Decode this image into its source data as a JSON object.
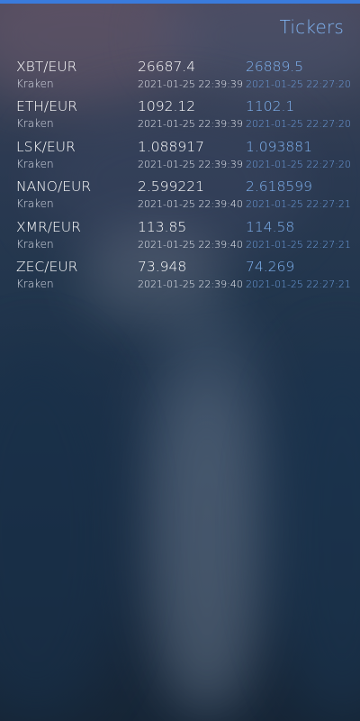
{
  "header": {
    "title": "Tickers"
  },
  "colors": {
    "accent": "#3a7bdc",
    "highlight": "#7fb2f0",
    "highlight_dim": "#6d9fe0",
    "text": "#ffffff",
    "secondary": "#d7dbe6"
  },
  "tickers": [
    {
      "pair": "XBT/EUR",
      "exchange": "Kraken",
      "price": "26687.4",
      "time": "2021-01-25 22:39:39",
      "prev_price": "26889.5",
      "prev_time": "2021-01-25 22:27:20"
    },
    {
      "pair": "ETH/EUR",
      "exchange": "Kraken",
      "price": "1092.12",
      "time": "2021-01-25 22:39:39",
      "prev_price": "1102.1",
      "prev_time": "2021-01-25 22:27:20"
    },
    {
      "pair": "LSK/EUR",
      "exchange": "Kraken",
      "price": "1.088917",
      "time": "2021-01-25 22:39:39",
      "prev_price": "1.093881",
      "prev_time": "2021-01-25 22:27:20"
    },
    {
      "pair": "NANO/EUR",
      "exchange": "Kraken",
      "price": "2.599221",
      "time": "2021-01-25 22:39:40",
      "prev_price": "2.618599",
      "prev_time": "2021-01-25 22:27:21"
    },
    {
      "pair": "XMR/EUR",
      "exchange": "Kraken",
      "price": "113.85",
      "time": "2021-01-25 22:39:40",
      "prev_price": "114.58",
      "prev_time": "2021-01-25 22:27:21"
    },
    {
      "pair": "ZEC/EUR",
      "exchange": "Kraken",
      "price": "73.948",
      "time": "2021-01-25 22:39:40",
      "prev_price": "74.269",
      "prev_time": "2021-01-25 22:27:21"
    }
  ]
}
